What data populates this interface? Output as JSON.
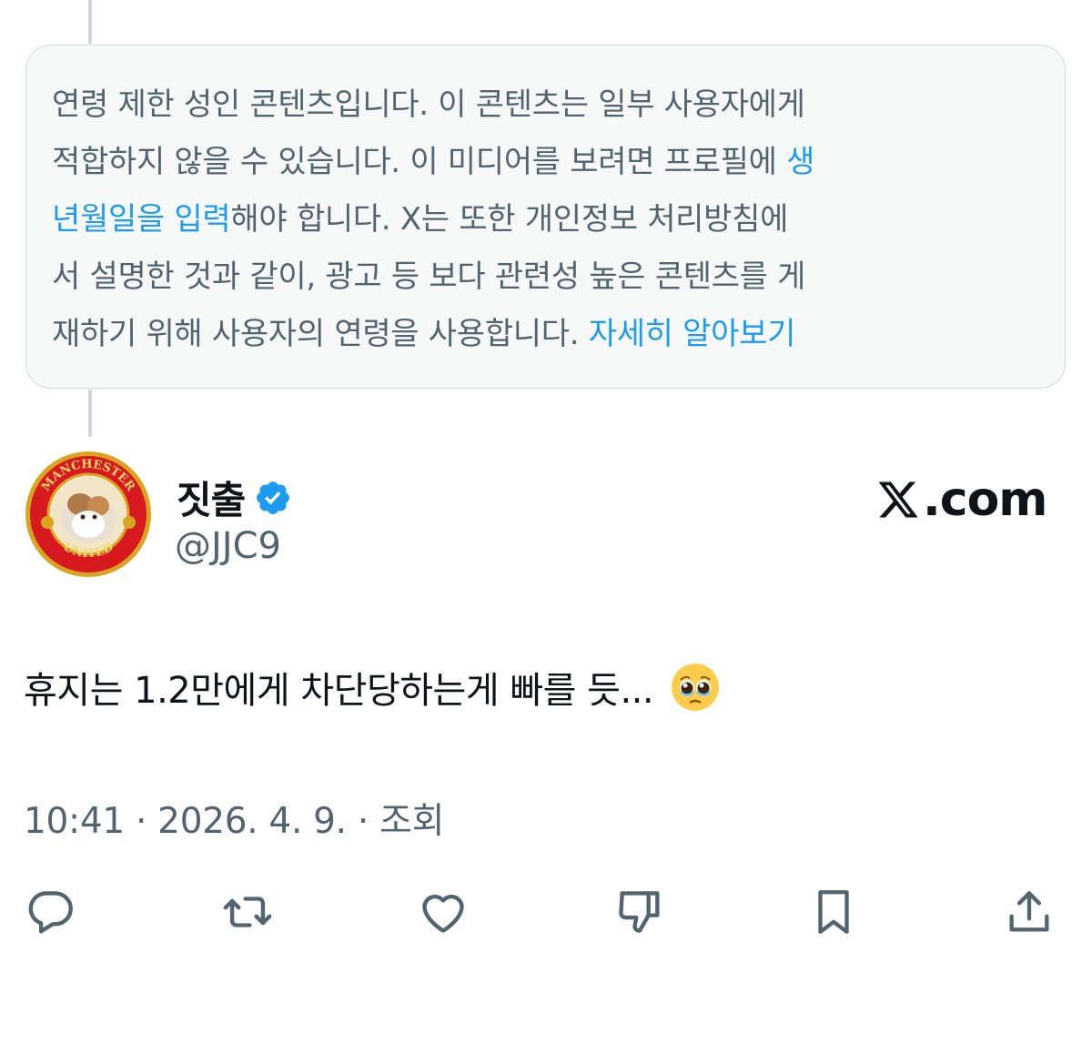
{
  "notice": {
    "lines": [
      [
        {
          "text": "연령 제한 성인 콘텐츠입니다. 이 콘텐츠는 일부 사용자에게",
          "link": false
        }
      ],
      [
        {
          "text": "적합하지 않을 수 있습니다. 이 미디어를 보려면 프로필에 ",
          "link": false
        },
        {
          "text": "생",
          "link": true
        }
      ],
      [
        {
          "text": "년월일을 입력",
          "link": true
        },
        {
          "text": "해야 합니다. X는 또한 개인정보 처리방침에",
          "link": false
        }
      ],
      [
        {
          "text": "서 설명한 것과 같이, 광고 등 보다 관련성 높은 콘텐츠를 게",
          "link": false
        }
      ],
      [
        {
          "text": "재하기 위해 사용자의 연령을 사용합니다. ",
          "link": false
        },
        {
          "text": "자세히 알아보기",
          "link": true
        }
      ]
    ],
    "link_color": "#1d9bf0"
  },
  "author": {
    "display_name": "짓출",
    "handle": "@JJC9",
    "verified": true,
    "avatar_icon": "manchester-united-crest-cat-avatar",
    "avatar_text_top": "MANCHESTER",
    "avatar_text_bottom": "UNITED"
  },
  "brand": {
    "text": ".com",
    "icon": "x-logo-icon"
  },
  "tweet": {
    "text": "휴지는 1.2만에게 차단당하는게 빠를 듯...",
    "emoji": "pleading-face-emoji"
  },
  "meta": {
    "line": "10:41 · 2026. 4. 9. · 조회"
  },
  "actions": [
    {
      "name": "reply-button",
      "icon": "reply-icon"
    },
    {
      "name": "retweet-button",
      "icon": "retweet-icon"
    },
    {
      "name": "like-button",
      "icon": "heart-icon"
    },
    {
      "name": "dislike-button",
      "icon": "thumbs-down-icon"
    },
    {
      "name": "bookmark-button",
      "icon": "bookmark-icon"
    },
    {
      "name": "share-button",
      "icon": "share-icon"
    }
  ],
  "colors": {
    "text_primary": "#0f1419",
    "text_secondary": "#536471",
    "verified_badge": "#1d9bf0",
    "notice_bg": "#f7f9f9",
    "border": "#cfd9de"
  }
}
